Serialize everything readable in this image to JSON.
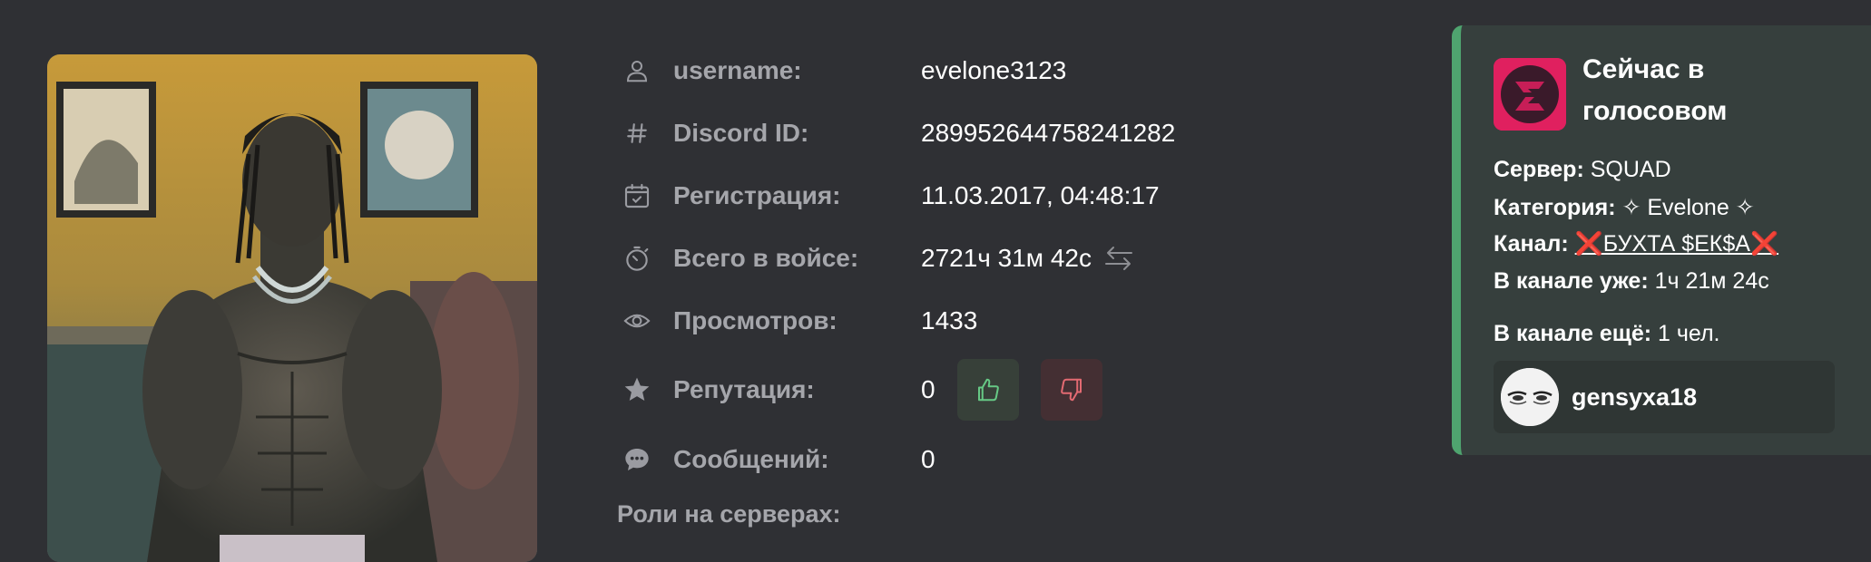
{
  "profile": {
    "rows": [
      {
        "label": "username:",
        "value": "evelone3123",
        "icon": "user-icon"
      },
      {
        "label": "Discord ID:",
        "value": "289952644758241282",
        "icon": "hash-icon"
      },
      {
        "label": "Регистрация:",
        "value": "11.03.2017, 04:48:17",
        "icon": "calendar-check-icon"
      },
      {
        "label": "Всего в войсе:",
        "value": "2721ч 31м 42с",
        "icon": "stopwatch-icon"
      },
      {
        "label": "Просмотров:",
        "value": "1433",
        "icon": "eye-icon"
      },
      {
        "label": "Репутация:",
        "value": "0",
        "icon": "star-icon"
      },
      {
        "label": "Сообщений:",
        "value": "0",
        "icon": "chat-bubble-icon"
      }
    ],
    "roles_title": "Роли на серверах:"
  },
  "voice": {
    "title": "Сейчас в голосовом",
    "server_label": "Сервер:",
    "server_value": "SQUAD",
    "category_label": "Категория:",
    "category_value": "✧ Evelone ✧",
    "channel_label": "Канал:",
    "channel_value": "❌БУХТА $ЕК$А❌",
    "in_channel_label": "В канале уже:",
    "in_channel_value": "1ч 21м 24с",
    "more_label": "В канале ещё:",
    "more_value": "1 чел.",
    "member_name": "gensyxa18"
  },
  "colors": {
    "background": "#2f3034",
    "card_accent": "#4fa46f",
    "upvote": "#66c985",
    "downvote": "#e36a72",
    "server_logo": "#e0205f"
  }
}
